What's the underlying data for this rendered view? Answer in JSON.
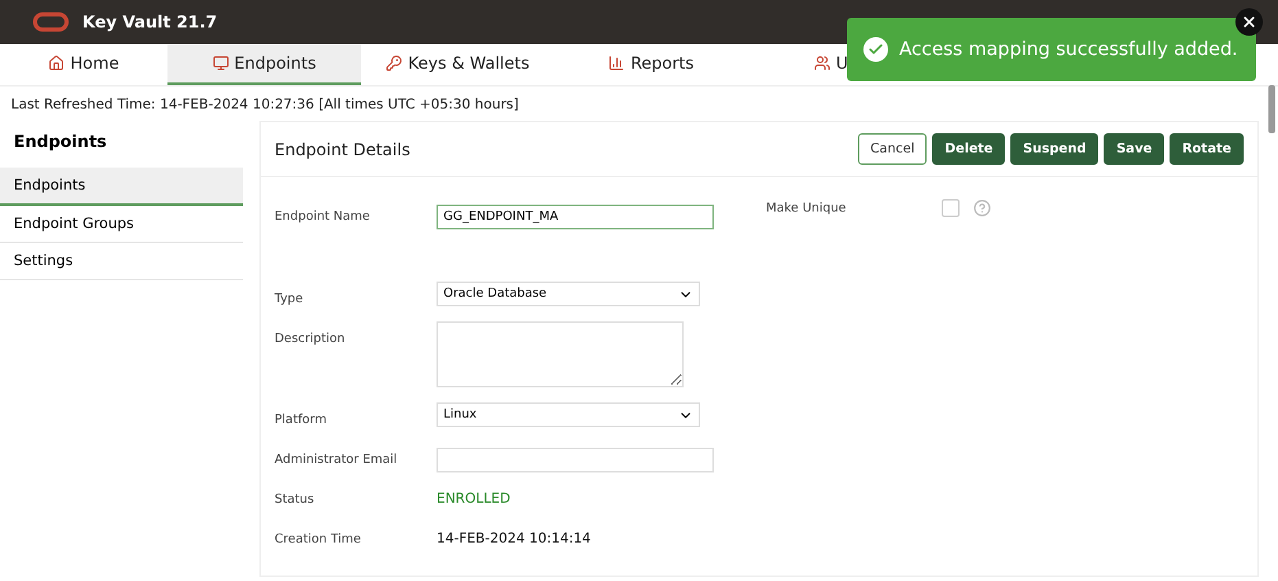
{
  "header": {
    "product": "Key Vault 21.7"
  },
  "tabs": [
    {
      "label": "Home",
      "selected": false
    },
    {
      "label": "Endpoints",
      "selected": true
    },
    {
      "label": "Keys & Wallets",
      "selected": false
    },
    {
      "label": "Reports",
      "selected": false
    },
    {
      "label": "U",
      "selected": false
    }
  ],
  "refresh": "Last Refreshed Time: 14-FEB-2024 10:27:36 [All times UTC +05:30 hours]",
  "sidebar": {
    "title": "Endpoints",
    "items": [
      {
        "label": "Endpoints",
        "selected": true
      },
      {
        "label": "Endpoint Groups",
        "selected": false
      },
      {
        "label": "Settings",
        "selected": false
      }
    ]
  },
  "panel": {
    "title": "Endpoint Details",
    "buttons": [
      {
        "label": "Cancel",
        "kind": "outline"
      },
      {
        "label": "Delete",
        "kind": "solid"
      },
      {
        "label": "Suspend",
        "kind": "solid"
      },
      {
        "label": "Save",
        "kind": "solid"
      },
      {
        "label": "Rotate",
        "kind": "solid"
      }
    ],
    "make_unique": {
      "label": "Make Unique",
      "checked": false
    },
    "fields": [
      {
        "label": "Endpoint Name",
        "kind": "input",
        "value": "GG_ENDPOINT_MA",
        "focused": true
      },
      {
        "label": "Type",
        "kind": "select",
        "value": "Oracle Database"
      },
      {
        "label": "Description",
        "kind": "textarea"
      },
      {
        "label": "Platform",
        "kind": "select",
        "value": "Linux"
      },
      {
        "label": "Administrator Email",
        "kind": "input",
        "focused": false
      },
      {
        "label": "Status",
        "kind": "status",
        "value": "ENROLLED"
      },
      {
        "label": "Creation Time",
        "kind": "text",
        "value": "14-FEB-2024 10:14:14"
      }
    ]
  },
  "toast": {
    "message": "Access mapping successfully added."
  }
}
